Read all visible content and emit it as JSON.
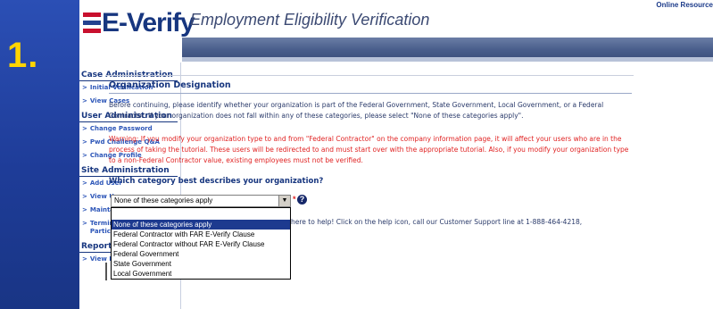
{
  "slide": {
    "step_number": "1."
  },
  "header": {
    "logo_text": "E-Verify",
    "title": "Employment Eligibility Verification",
    "online_resources": "Online Resource"
  },
  "sidebar": {
    "sections": [
      {
        "title": "Case Administration",
        "links": [
          "Initial Verification",
          "View Cases"
        ]
      },
      {
        "title": "User Administration",
        "links": [
          "Change Password",
          "Pwd Challenge Q&A",
          "Change Profile"
        ]
      },
      {
        "title": "Site Administration",
        "links": [
          "Add User",
          "View Users",
          "Maintain Company",
          "Terminate Company Participation"
        ]
      },
      {
        "title": "Reports",
        "links": [
          "View Reports"
        ]
      }
    ]
  },
  "main": {
    "page_title": "Organization Designation",
    "intro": "Before continuing, please identify whether your organization is part of the Federal Government, State Government, Local Government, or a Federal Contractor. If your organization does not fall within any of these categories, please select \"None of these categories apply\".",
    "warning": "Warning: If you modify your organization type to and from \"Federal Contractor\" on the company information page, it will affect your users who are in the process of taking the tutorial. These users will be redirected to and must start over with the appropriate tutorial. Also, if you modify your organization type to a non-Federal Contractor value, existing employees must not be verified.",
    "question": "Which category best describes your organization?",
    "select_value": "None of these categories apply",
    "required_mark": "*",
    "help_icon": "?",
    "help_text": "here to help! Click on the help icon, call our Customer Support line at 1-888-464-4218,",
    "options": [
      "None of these categories apply",
      "Federal Contractor with FAR E-Verify Clause",
      "Federal Contractor without FAR E-Verify Clause",
      "Federal Government",
      "State Government",
      "Local Government"
    ],
    "selected_option_index": 0
  },
  "colors": {
    "slide_bg": "#1f3f9e",
    "step_number": "#ffd400",
    "brand_blue": "#17367f",
    "link_blue": "#2d56b8",
    "warning_red": "#e02323",
    "selected_option": "#1d3a8f"
  }
}
